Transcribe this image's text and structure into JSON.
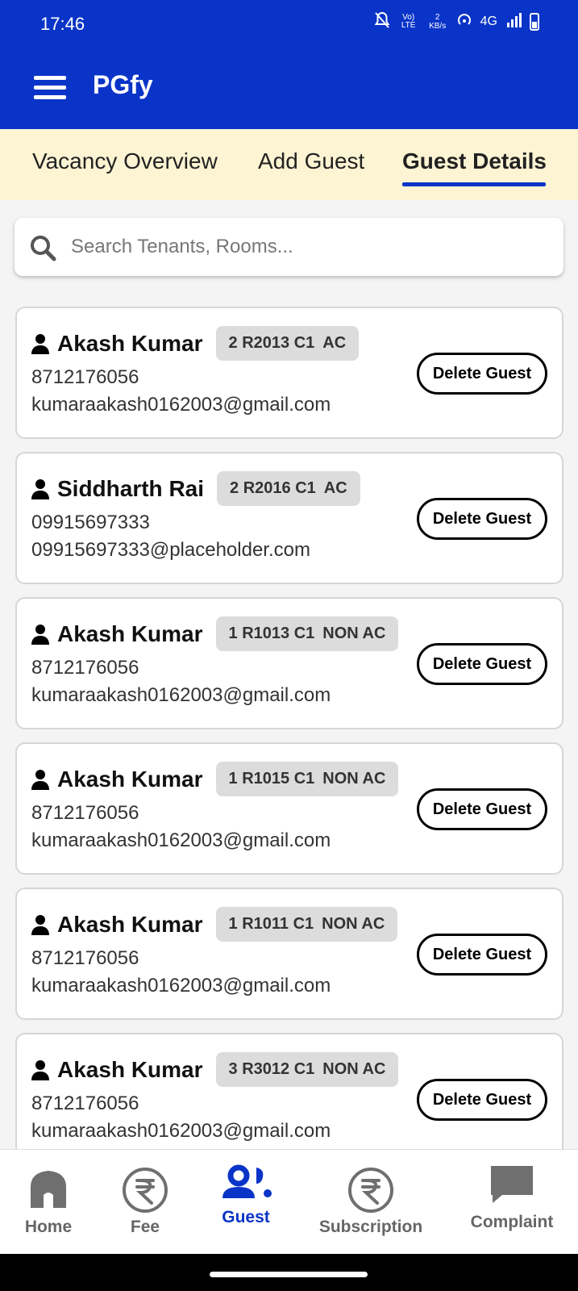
{
  "status_bar": {
    "time": "17:46",
    "volte": "Vo) LTE",
    "speed": "2 KB/s",
    "network": "4G"
  },
  "app_bar": {
    "title": "PGfy"
  },
  "tabs": [
    {
      "label": "Vacancy Overview",
      "active": false
    },
    {
      "label": "Add Guest",
      "active": false
    },
    {
      "label": "Guest Details",
      "active": true
    }
  ],
  "search": {
    "placeholder": "Search Tenants, Rooms...",
    "value": ""
  },
  "guests": [
    {
      "name": "Akash Kumar",
      "room": "2 R2013 C1",
      "type": "AC",
      "phone": "8712176056",
      "email": "kumaraakash0162003@gmail.com",
      "action": "Delete Guest"
    },
    {
      "name": "Siddharth Rai",
      "room": "2 R2016 C1",
      "type": "AC",
      "phone": "09915697333",
      "email": "09915697333@placeholder.com",
      "action": "Delete Guest"
    },
    {
      "name": "Akash Kumar",
      "room": "1 R1013 C1",
      "type": "NON AC",
      "phone": "8712176056",
      "email": "kumaraakash0162003@gmail.com",
      "action": "Delete Guest"
    },
    {
      "name": "Akash Kumar",
      "room": "1 R1015 C1",
      "type": "NON AC",
      "phone": "8712176056",
      "email": "kumaraakash0162003@gmail.com",
      "action": "Delete Guest"
    },
    {
      "name": "Akash Kumar",
      "room": "1 R1011 C1",
      "type": "NON AC",
      "phone": "8712176056",
      "email": "kumaraakash0162003@gmail.com",
      "action": "Delete Guest"
    },
    {
      "name": "Akash Kumar",
      "room": "3 R3012 C1",
      "type": "NON AC",
      "phone": "8712176056",
      "email": "kumaraakash0162003@gmail.com",
      "action": "Delete Guest"
    }
  ],
  "bottom_nav": [
    {
      "label": "Home",
      "icon": "home-icon",
      "active": false
    },
    {
      "label": "Fee",
      "icon": "rupee-icon",
      "active": false
    },
    {
      "label": "Guest",
      "icon": "guests-icon",
      "active": true
    },
    {
      "label": "Subscription",
      "icon": "rupee-icon",
      "active": false
    },
    {
      "label": "Complaint",
      "icon": "chat-bubble-icon",
      "active": false
    }
  ],
  "colors": {
    "primary": "#0a34c8",
    "tab_background": "#fdf4d3",
    "badge_background": "#dcdcdc"
  }
}
